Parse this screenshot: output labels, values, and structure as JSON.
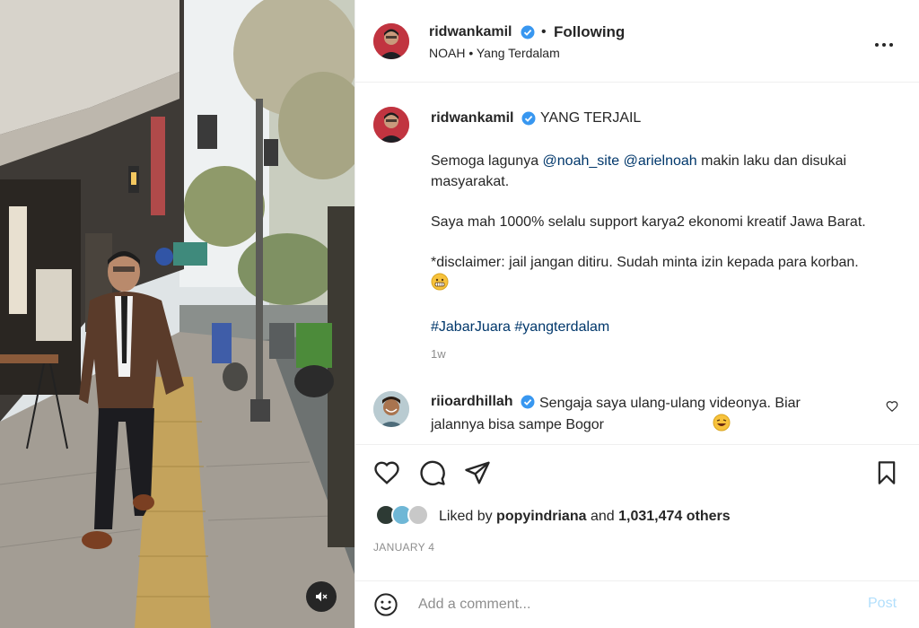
{
  "header": {
    "username": "ridwankamil",
    "separator": "•",
    "follow_status": "Following",
    "subtitle": "NOAH • Yang Terdalam"
  },
  "caption": {
    "username": "ridwankamil",
    "title": "YANG TERJAIL",
    "line1_pre": "Semoga lagunya ",
    "mention1": "@noah_site",
    "mention2": "@arielnoah",
    "line1_post": " makin laku dan disukai masyarakat.",
    "para2": "Saya mah 1000% selalu support karya2 ekonomi kreatif Jawa Barat.",
    "para3": "*disclaimer: jail jangan ditiru. Sudah minta izin kepada para korban.",
    "hashtag1": "#JabarJuara",
    "hashtag2": "#yangterdalam",
    "time": "1w"
  },
  "comment": {
    "username": "riioardhillah",
    "text": "Sengaja saya ulang-ulang videonya. Biar jalannya bisa sampe Bogor"
  },
  "likes": {
    "prefix": "Liked by ",
    "liker": "popyindriana",
    "middle": " and ",
    "count_text": "1,031,474 others"
  },
  "date": "JANUARY 4",
  "add_comment": {
    "placeholder": "Add a comment...",
    "post_label": "Post"
  },
  "icons": {
    "more": "more-horizontal-icon",
    "like": "heart-icon",
    "comment": "comment-icon",
    "share": "share-icon",
    "save": "bookmark-icon",
    "emoji": "smile-icon",
    "mute": "muted-speaker-icon",
    "verified": "verified-badge-icon"
  },
  "colors": {
    "verified": "#3897f0",
    "link": "#00376b",
    "muted_text": "#8e8e8e",
    "post_disabled": "#b2dffc"
  }
}
